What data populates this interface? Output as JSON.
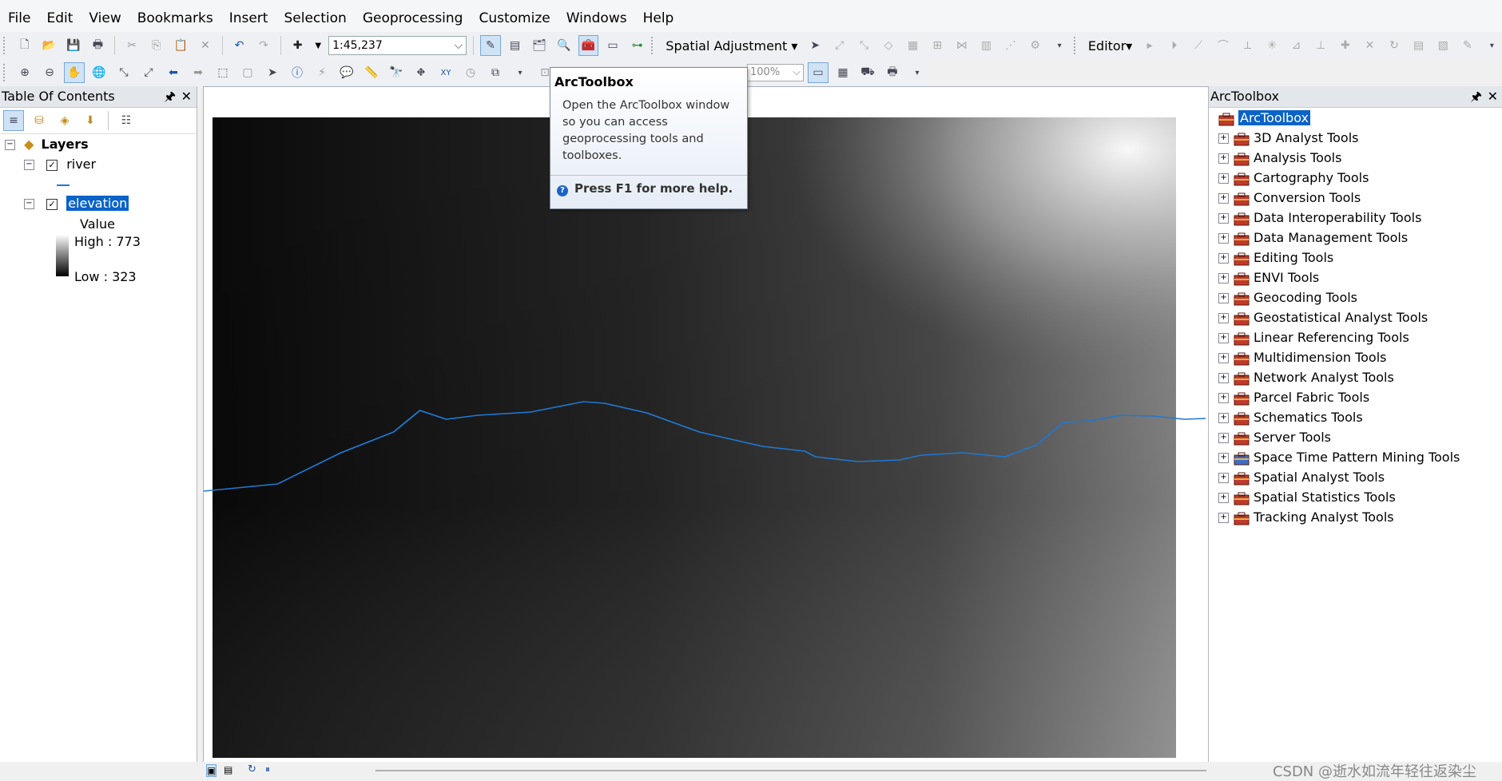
{
  "menu": [
    "File",
    "Edit",
    "View",
    "Bookmarks",
    "Insert",
    "Selection",
    "Geoprocessing",
    "Customize",
    "Windows",
    "Help"
  ],
  "toolbar": {
    "scale_value": "1:45,237",
    "spatial_adjustment_label": "Spatial Adjustment",
    "editor_label": "Editor",
    "zoom_value": "100%"
  },
  "toc": {
    "title": "Table Of Contents",
    "root_label": "Layers",
    "layers": [
      {
        "name": "river",
        "checked": true
      },
      {
        "name": "elevation",
        "checked": true,
        "selected": true
      }
    ],
    "legend": {
      "header": "Value",
      "high": "High : 773",
      "low": "Low : 323"
    }
  },
  "tooltip": {
    "title": "ArcToolbox",
    "body": "Open the ArcToolbox window so you can access geoprocessing tools and toolboxes.",
    "help": "Press F1 for more help."
  },
  "toolbox": {
    "title": "ArcToolbox",
    "root_label": "ArcToolbox",
    "items": [
      "3D Analyst Tools",
      "Analysis Tools",
      "Cartography Tools",
      "Conversion Tools",
      "Data Interoperability Tools",
      "Data Management Tools",
      "Editing Tools",
      "ENVI Tools",
      "Geocoding Tools",
      "Geostatistical Analyst Tools",
      "Linear Referencing Tools",
      "Multidimension Tools",
      "Network Analyst Tools",
      "Parcel Fabric Tools",
      "Schematics Tools",
      "Server Tools",
      "Space Time Pattern Mining Tools",
      "Spatial Analyst Tools",
      "Spatial Statistics Tools",
      "Tracking Analyst Tools"
    ]
  },
  "watermark": "CSDN @逝水如流年轻往返染尘",
  "colors": {
    "river": "#1f78d1",
    "selection": "#0a63c9"
  }
}
